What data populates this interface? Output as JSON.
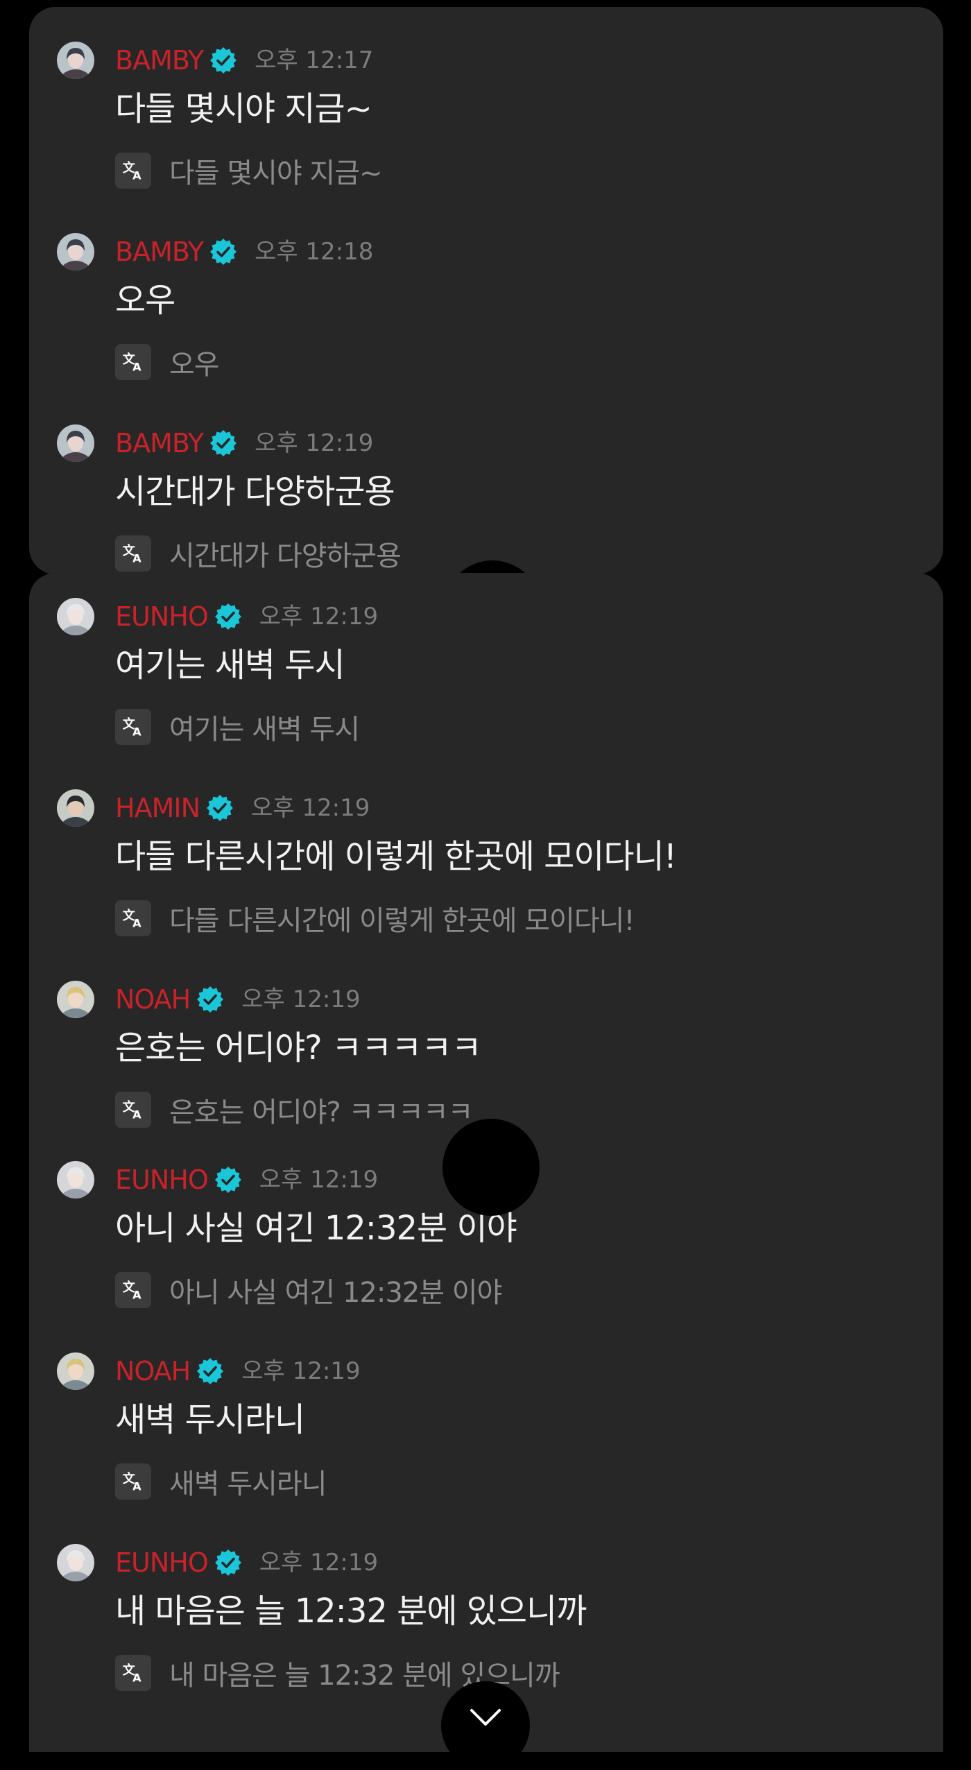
{
  "colors": {
    "background": "#000000",
    "panel": "#272727",
    "username": "#c8222a",
    "timestamp": "#7c7c7c",
    "message_text": "#f2f2f2",
    "translation_text": "#8a8a8a",
    "verified_badge": "#1bc6d8"
  },
  "icons": {
    "verified": "verified-badge-icon",
    "translate": "translate-icon",
    "scroll": "chevron-down-icon"
  },
  "messages": [
    {
      "user": "BAMBY",
      "time": "오후 12:17",
      "text": "다들 몇시야 지금~",
      "translation": "다들 몇시야 지금~"
    },
    {
      "user": "BAMBY",
      "time": "오후 12:18",
      "text": "오우",
      "translation": "오우"
    },
    {
      "user": "BAMBY",
      "time": "오후 12:19",
      "text": "시간대가 다양하군용",
      "translation": "시간대가 다양하군용"
    },
    {
      "user": "EUNHO",
      "time": "오후 12:19",
      "text": "여기는 새벽 두시",
      "translation": "여기는 새벽 두시"
    },
    {
      "user": "HAMIN",
      "time": "오후 12:19",
      "text": "다들 다른시간에 이렇게 한곳에 모이다니!",
      "translation": "다들 다른시간에 이렇게 한곳에 모이다니!"
    },
    {
      "user": "NOAH",
      "time": "오후 12:19",
      "text": "은호는 어디야? ㅋㅋㅋㅋㅋ",
      "translation": "은호는 어디야? ㅋㅋㅋㅋㅋ"
    },
    {
      "user": "EUNHO",
      "time": "오후 12:19",
      "text": "아니 사실 여긴 12:32분 이야",
      "translation": "아니 사실 여긴 12:32분 이야"
    },
    {
      "user": "NOAH",
      "time": "오후 12:19",
      "text": "새벽 두시라니",
      "translation": "새벽 두시라니"
    },
    {
      "user": "EUNHO",
      "time": "오후 12:19",
      "text": "내 마음은 늘 12:32 분에 있으니까",
      "translation": "내 마음은 늘 12:32 분에 있으니까"
    }
  ]
}
